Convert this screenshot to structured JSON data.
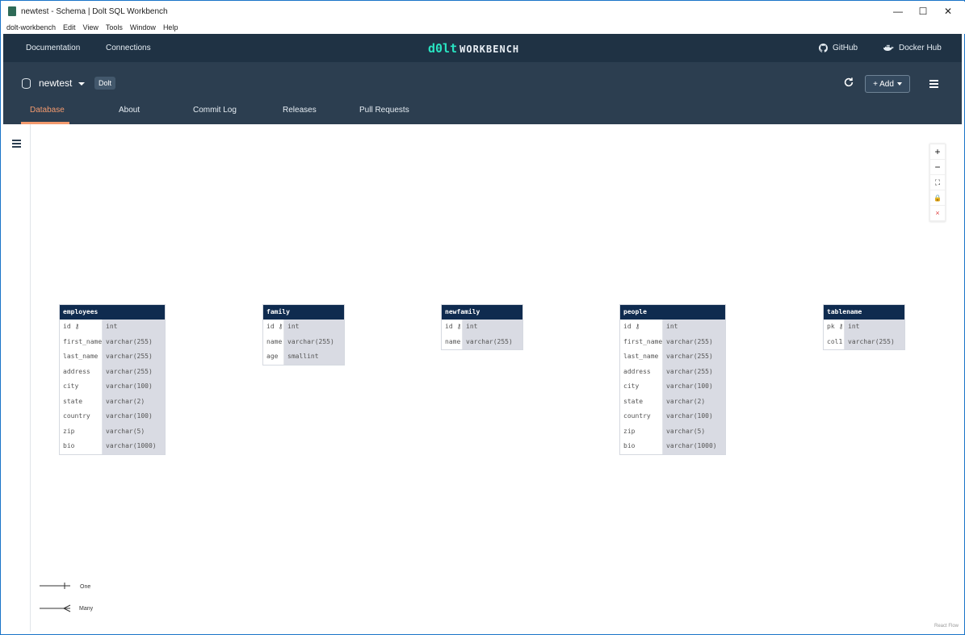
{
  "window": {
    "title": "newtest - Schema | Dolt SQL Workbench",
    "controls": {
      "minimize": "—",
      "maximize": "☐",
      "close": "✕"
    }
  },
  "menubar": [
    "dolt-workbench",
    "Edit",
    "View",
    "Tools",
    "Window",
    "Help"
  ],
  "topnav": {
    "left": [
      "Documentation",
      "Connections"
    ],
    "logo_dolt": "d0lt",
    "logo_workbench": "WORKBENCH",
    "github": "GitHub",
    "docker": "Docker Hub"
  },
  "header": {
    "database": "newtest",
    "badge": "Dolt",
    "add_label": "+ Add",
    "tabs": [
      "Database",
      "About",
      "Commit Log",
      "Releases",
      "Pull Requests"
    ],
    "active_tab": "Database"
  },
  "controls": [
    "+",
    "−",
    "⛶",
    "🔒",
    "×"
  ],
  "tables": [
    {
      "name": "employees",
      "columns": [
        [
          "id",
          "int",
          true
        ],
        [
          "first_name",
          "varchar(255)",
          false
        ],
        [
          "last_name",
          "varchar(255)",
          false
        ],
        [
          "address",
          "varchar(255)",
          false
        ],
        [
          "city",
          "varchar(100)",
          false
        ],
        [
          "state",
          "varchar(2)",
          false
        ],
        [
          "country",
          "varchar(100)",
          false
        ],
        [
          "zip",
          "varchar(5)",
          false
        ],
        [
          "bio",
          "varchar(1000)",
          false
        ]
      ]
    },
    {
      "name": "family",
      "columns": [
        [
          "id",
          "int",
          true
        ],
        [
          "name",
          "varchar(255)",
          false
        ],
        [
          "age",
          "smallint",
          false
        ]
      ]
    },
    {
      "name": "newfamily",
      "columns": [
        [
          "id",
          "int",
          true
        ],
        [
          "name",
          "varchar(255)",
          false
        ]
      ]
    },
    {
      "name": "people",
      "columns": [
        [
          "id",
          "int",
          true
        ],
        [
          "first_name",
          "varchar(255)",
          false
        ],
        [
          "last_name",
          "varchar(255)",
          false
        ],
        [
          "address",
          "varchar(255)",
          false
        ],
        [
          "city",
          "varchar(100)",
          false
        ],
        [
          "state",
          "varchar(2)",
          false
        ],
        [
          "country",
          "varchar(100)",
          false
        ],
        [
          "zip",
          "varchar(5)",
          false
        ],
        [
          "bio",
          "varchar(1000)",
          false
        ]
      ]
    },
    {
      "name": "tablename",
      "columns": [
        [
          "pk",
          "int",
          true
        ],
        [
          "col1",
          "varchar(255)",
          false
        ]
      ]
    }
  ],
  "legend": {
    "one": "One",
    "many": "Many"
  },
  "attribution": "React Flow"
}
